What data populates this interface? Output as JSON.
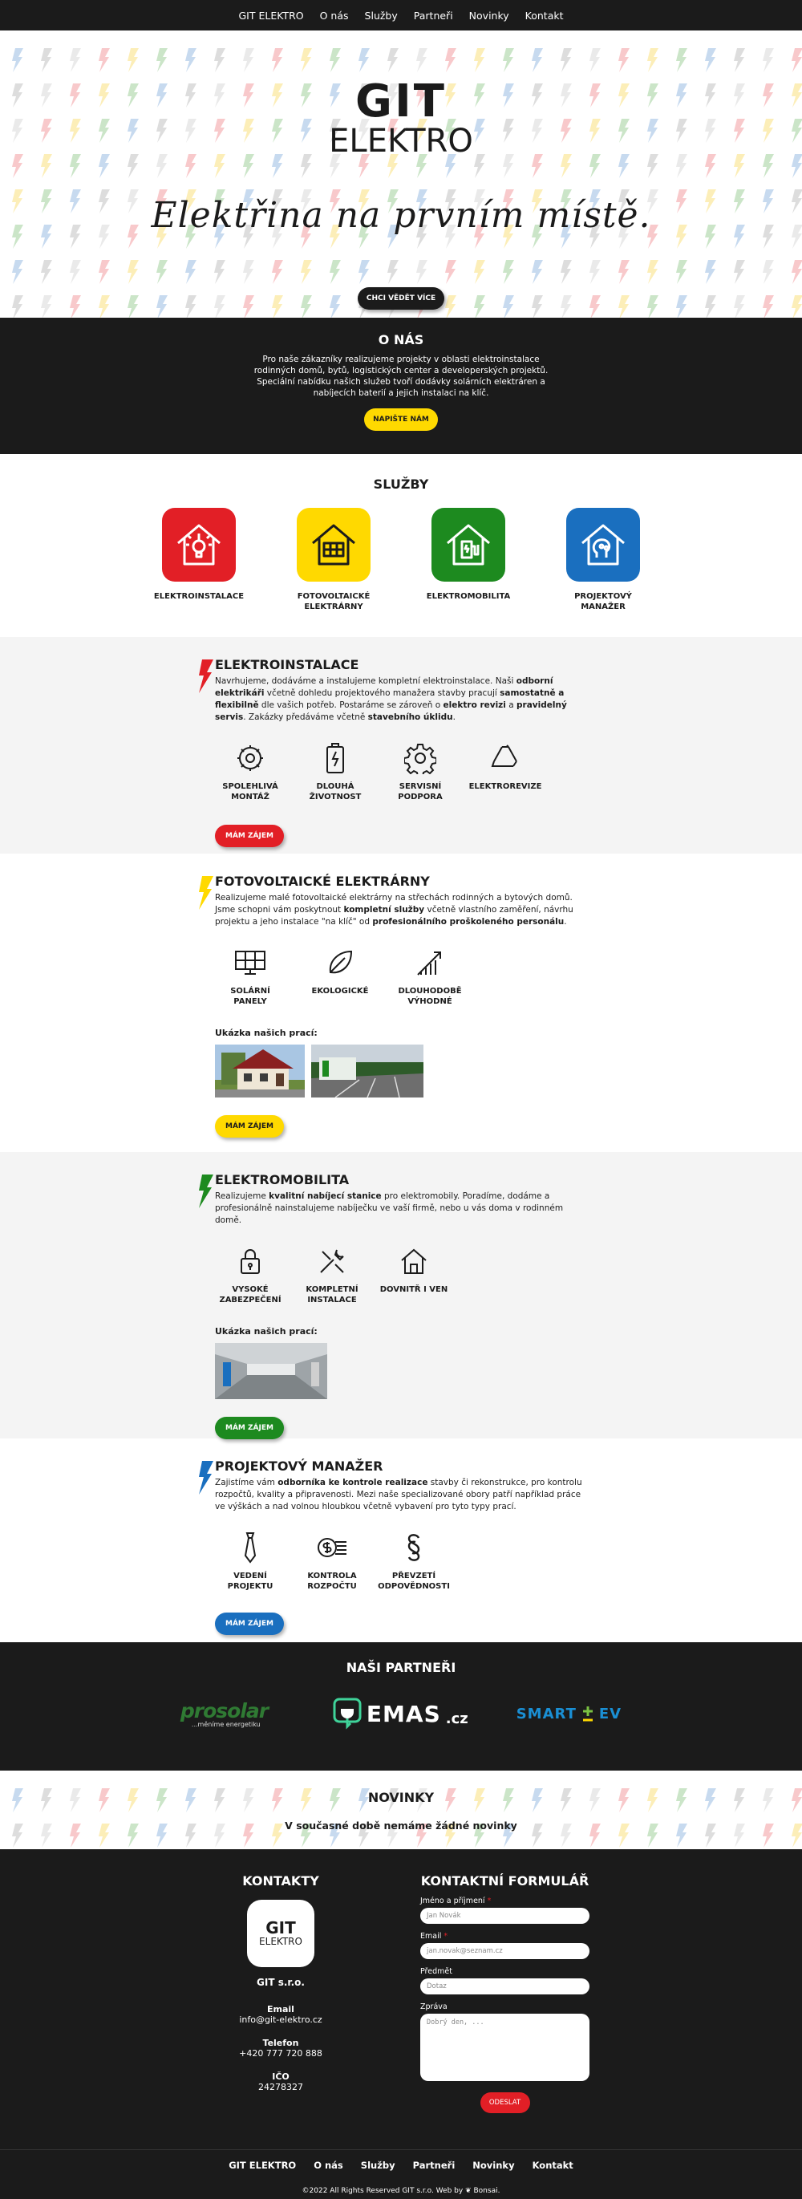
{
  "nav": {
    "items": [
      "GIT ELEKTRO",
      "O nás",
      "Služby",
      "Partneři",
      "Novinky",
      "Kontakt"
    ]
  },
  "hero": {
    "logo_top": "GIT",
    "logo_bottom": "ELEKTRO",
    "tagline": "Elektřina na prvním místě.",
    "button": "CHCI VĚDĚT VÍCE"
  },
  "about": {
    "title": "O NÁS",
    "text": "Pro naše zákazníky realizujeme projekty v oblasti elektroinstalace rodinných domů, bytů, logistických center a developerských projektů. Speciální nabídku našich služeb tvoří dodávky solárních elektráren a nabíjecích baterií a jejich instalaci na klíč.",
    "button": "NAPIŠTE NÁM"
  },
  "services": {
    "title": "SLUŽBY",
    "cards": [
      {
        "label": "ELEKTROINSTALACE",
        "color": "#e21f26"
      },
      {
        "label": "FOTOVOLTAICKÉ ELEKTRÁRNY",
        "color": "#ffd900"
      },
      {
        "label": "ELEKTROMOBILITA",
        "color": "#1d8a1f"
      },
      {
        "label": "PROJEKTOVÝ MANAŽER",
        "color": "#1a6fbf"
      }
    ]
  },
  "sections": {
    "elektro": {
      "title": "ELEKTROINSTALACE",
      "p1": "Navrhujeme, dodáváme a instalujeme kompletní elektroinstalace. Naši ",
      "b1": "odborní elektrikáři",
      "p2": " včetně dohledu projektového manažera stavby pracují ",
      "b2": "samostatně a flexibilně",
      "p3": " dle vašich potřeb. Postaráme se zároveň o ",
      "b3": "elektro revizi",
      "p4": " a ",
      "b4": "pravidelný servis",
      "p5": ". Zakázky předáváme včetně ",
      "b5": "stavebního úklidu",
      "p6": ".",
      "features": [
        "SPOLEHLIVÁ MONTÁŽ",
        "DLOUHÁ ŽIVOTNOST",
        "SERVISNÍ PODPORA",
        "ELEKTROREVIZE"
      ],
      "button": "MÁM ZÁJEM"
    },
    "fve": {
      "title": "FOTOVOLTAICKÉ ELEKTRÁRNY",
      "p1": "Realizujeme malé fotovoltaické elektrárny na střechách rodinných a bytových domů. Jsme schopni vám poskytnout ",
      "b1": "kompletní služby",
      "p2": " včetně vlastního zaměření, návrhu projektu a jeho instalace \"na klíč\" od ",
      "b2": "profesionálního proškoleného personálu",
      "p3": ".",
      "features": [
        "SOLÁRNÍ PANELY",
        "EKOLOGICKÉ",
        "DLOUHODOBĚ VÝHODNÉ"
      ],
      "gallery_title": "Ukázka našich prací:",
      "button": "MÁM ZÁJEM"
    },
    "emob": {
      "title": "ELEKTROMOBILITA",
      "p1": "Realizujeme ",
      "b1": "kvalitní nabíjecí stanice",
      "p2": " pro elektromobily. Poradíme, dodáme a profesionálně nainstalujeme nabíječku ve vaší firmě, nebo u vás doma v rodinném domě.",
      "features": [
        "VYSOKÉ ZABEZPEČENÍ",
        "KOMPLETNÍ INSTALACE",
        "DOVNITŘ I VEN"
      ],
      "gallery_title": "Ukázka našich prací:",
      "button": "MÁM ZÁJEM"
    },
    "pm": {
      "title": "PROJEKTOVÝ MANAŽER",
      "p1": "Zajistíme vám ",
      "b1": "odborníka ke kontrole realizace",
      "p2": " stavby či rekonstrukce, pro kontrolu rozpočtů, kvality a připravenosti. Mezi naše specializované obory patří například práce ve výškách a nad volnou hloubkou včetně vybavení pro tyto typy prací.",
      "features": [
        "VEDENÍ PROJEKTU",
        "KONTROLA ROZPOČTU",
        "PŘEVZETÍ ODPOVĚDNOSTI"
      ],
      "button": "MÁM ZÁJEM"
    }
  },
  "partners": {
    "title": "NAŠI PARTNEŘI",
    "prosolar": "prosolar",
    "prosolar_sub": "...měníme energetiku",
    "emas": "EMAS",
    "emas_tld": ".cz",
    "smart": "SMART",
    "ev": "EV"
  },
  "news": {
    "title": "NOVINKY",
    "text": "V současné době nemáme žádné novinky"
  },
  "contacts": {
    "title": "KONTAKTY",
    "logo_top": "GIT",
    "logo_bottom": "ELEKTRO",
    "company": "GIT s.r.o.",
    "email_label": "Email",
    "email": "info@git-elektro.cz",
    "phone_label": "Telefon",
    "phone": "+420 777 720 888",
    "ico_label": "IČO",
    "ico": "24278327"
  },
  "form": {
    "title": "KONTAKTNÍ FORMULÁŘ",
    "name_label": "Jméno a příjmení",
    "name_placeholder": "Jan Novák",
    "email_label": "Email",
    "email_placeholder": "jan.novak@seznam.cz",
    "subject_label": "Předmět",
    "subject_placeholder": "Dotaz",
    "message_label": "Zpráva",
    "message_placeholder": "Dobrý den, ...",
    "required_mark": "*",
    "submit": "ODESLAT"
  },
  "footer": {
    "links": [
      "GIT ELEKTRO",
      "O nás",
      "Služby",
      "Partneři",
      "Novinky",
      "Kontakt"
    ],
    "copyright": "©2022 All Rights Reserved GIT s.r.o. Web by",
    "credit": "Bonsai."
  }
}
